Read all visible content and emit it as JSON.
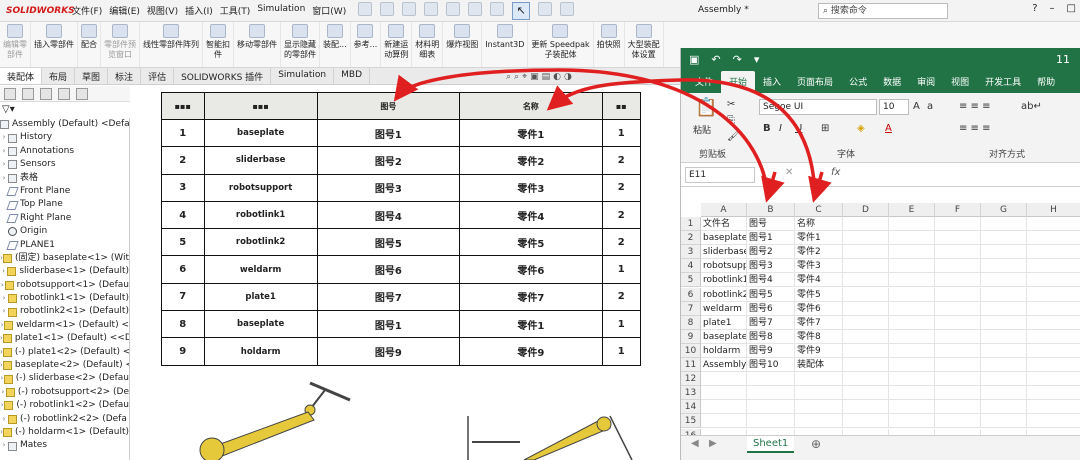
{
  "sw": {
    "logo": "SOLIDWORKS",
    "menu": [
      "文件(F)",
      "编辑(E)",
      "视图(V)",
      "插入(I)",
      "工具(T)",
      "Simulation",
      "窗口(W)"
    ],
    "doc_title": "Assembly *",
    "search_placeholder": "搜索命令",
    "ribbon": [
      {
        "label": "编辑零\n部件",
        "dim": true
      },
      {
        "label": "插入零部件"
      },
      {
        "label": "配合"
      },
      {
        "label": "零部件预\n览窗口",
        "dim": true
      },
      {
        "label": "线性零部件阵列"
      },
      {
        "label": "智能扣\n件"
      },
      {
        "label": "移动零部件"
      },
      {
        "label": "显示隐藏\n的零部件"
      },
      {
        "label": "装配..."
      },
      {
        "label": "参考..."
      },
      {
        "label": "新建运\n动算例"
      },
      {
        "label": "材料明\n细表"
      },
      {
        "label": "爆炸视图"
      },
      {
        "label": "Instant3D"
      },
      {
        "label": "更新 Speedpak\n子装配体"
      },
      {
        "label": "拍快照"
      },
      {
        "label": "大型装配\n体设置"
      }
    ],
    "tabs": [
      "装配体",
      "布局",
      "草图",
      "标注",
      "评估",
      "SOLIDWORKS 插件",
      "Simulation",
      "MBD"
    ],
    "active_tab": "装配体"
  },
  "tree": {
    "items": [
      {
        "label": "Assembly (Default) <Default",
        "icon": "assembly",
        "exp": ""
      },
      {
        "label": "History",
        "icon": "folder",
        "exp": "›"
      },
      {
        "label": "Annotations",
        "icon": "folder",
        "exp": "›"
      },
      {
        "label": "Sensors",
        "icon": "folder",
        "exp": "›"
      },
      {
        "label": "表格",
        "icon": "folder",
        "exp": "›"
      },
      {
        "label": "Front Plane",
        "icon": "plane",
        "exp": ""
      },
      {
        "label": "Top Plane",
        "icon": "plane",
        "exp": ""
      },
      {
        "label": "Right Plane",
        "icon": "plane",
        "exp": ""
      },
      {
        "label": "Origin",
        "icon": "origin",
        "exp": ""
      },
      {
        "label": "PLANE1",
        "icon": "plane",
        "exp": ""
      },
      {
        "label": "(固定) baseplate<1> (Wit",
        "icon": "part",
        "exp": "›"
      },
      {
        "label": "sliderbase<1> (Default)",
        "icon": "part",
        "exp": "›"
      },
      {
        "label": "robotsupport<1> (Defau",
        "icon": "part",
        "exp": "›"
      },
      {
        "label": "robotlink1<1> (Default)",
        "icon": "part",
        "exp": "›"
      },
      {
        "label": "robotlink2<1> (Default)",
        "icon": "part",
        "exp": "›"
      },
      {
        "label": "weldarm<1> (Default) <",
        "icon": "part",
        "exp": "›"
      },
      {
        "label": "plate1<1> (Default) <<D",
        "icon": "part",
        "exp": "›"
      },
      {
        "label": "(-) plate1<2> (Default) <",
        "icon": "part",
        "exp": "›"
      },
      {
        "label": "baseplate<2> (Default) <",
        "icon": "part",
        "exp": "›"
      },
      {
        "label": "(-) sliderbase<2> (Defau",
        "icon": "part",
        "exp": "›"
      },
      {
        "label": "(-) robotsupport<2> (De",
        "icon": "part",
        "exp": "›"
      },
      {
        "label": "(-) robotlink1<2> (Defau",
        "icon": "part",
        "exp": "›"
      },
      {
        "label": "(-) robotlink2<2> (Defa",
        "icon": "part",
        "exp": "›"
      },
      {
        "label": "(-) holdarm<1> (Default)",
        "icon": "part",
        "exp": "›"
      },
      {
        "label": "Mates",
        "icon": "folder",
        "exp": "›"
      }
    ]
  },
  "bom": {
    "headers": [
      "▪▪▪",
      "▪▪▪",
      "图号",
      "名称",
      "▪▪"
    ],
    "rows": [
      [
        "1",
        "baseplate",
        "图号1",
        "零件1",
        "1"
      ],
      [
        "2",
        "sliderbase",
        "图号2",
        "零件2",
        "2"
      ],
      [
        "3",
        "robotsupport",
        "图号3",
        "零件3",
        "2"
      ],
      [
        "4",
        "robotlink1",
        "图号4",
        "零件4",
        "2"
      ],
      [
        "5",
        "robotlink2",
        "图号5",
        "零件5",
        "2"
      ],
      [
        "6",
        "weldarm",
        "图号6",
        "零件6",
        "1"
      ],
      [
        "7",
        "plate1",
        "图号7",
        "零件7",
        "2"
      ],
      [
        "8",
        "baseplate",
        "图号1",
        "零件1",
        "1"
      ],
      [
        "9",
        "holdarm",
        "图号9",
        "零件9",
        "1"
      ]
    ]
  },
  "xl": {
    "tabs": [
      "文件",
      "开始",
      "插入",
      "页面布局",
      "公式",
      "数据",
      "审阅",
      "视图",
      "开发工具",
      "帮助"
    ],
    "active_tab": "开始",
    "title_right": "11",
    "clipboard_label": "剪贴板",
    "paste_label": "粘贴",
    "font_label": "字体",
    "align_label": "对齐方式",
    "font_name": "Segoe UI",
    "font_size": "10",
    "name_box": "E11",
    "fx": "fx",
    "col_headers": [
      "A",
      "B",
      "C",
      "D",
      "E",
      "F",
      "G",
      "H"
    ],
    "rows": [
      [
        "文件名",
        "图号",
        "名称"
      ],
      [
        "baseplate",
        "图号1",
        "零件1"
      ],
      [
        "sliderbase",
        "图号2",
        "零件2"
      ],
      [
        "robotsupport",
        "图号3",
        "零件3"
      ],
      [
        "robotlink1",
        "图号4",
        "零件4"
      ],
      [
        "robotlink2",
        "图号5",
        "零件5"
      ],
      [
        "weldarm",
        "图号6",
        "零件6"
      ],
      [
        "plate1",
        "图号7",
        "零件7"
      ],
      [
        "baseplate",
        "图号8",
        "零件8"
      ],
      [
        "holdarm",
        "图号9",
        "零件9"
      ],
      [
        "Assembly",
        "图号10",
        "装配体"
      ],
      [
        "",
        "",
        ""
      ],
      [
        "",
        "",
        ""
      ],
      [
        "",
        "",
        ""
      ],
      [
        "",
        "",
        ""
      ],
      [
        "",
        "",
        ""
      ]
    ],
    "sheet_tab": "Sheet1",
    "add_sheet": "⊕"
  },
  "colors": {
    "excel_green": "#217346",
    "annotation_red": "#e02020"
  }
}
